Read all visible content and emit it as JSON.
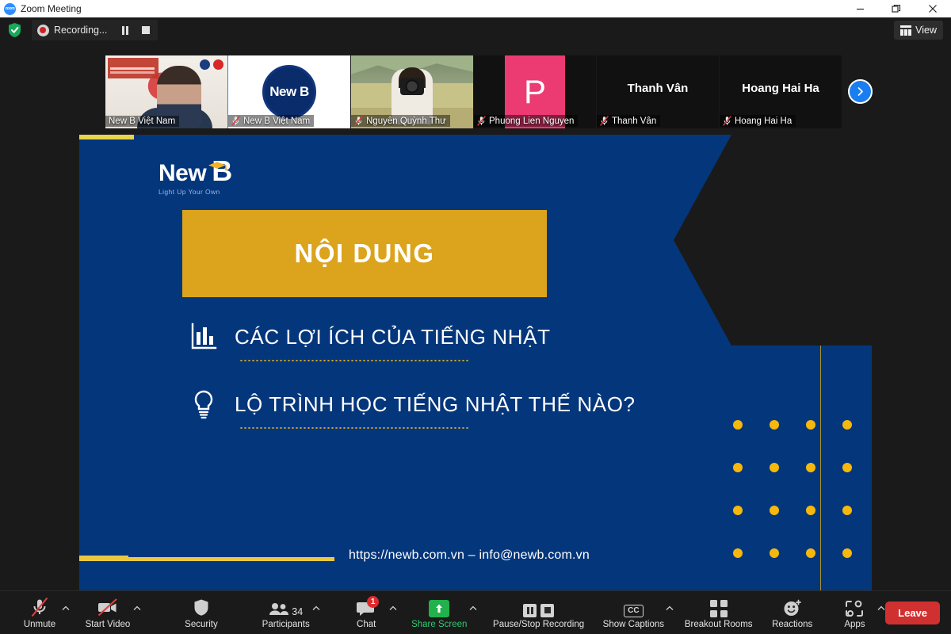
{
  "window": {
    "title": "Zoom Meeting",
    "app_icon": "zoom-logo-icon",
    "minimize": "—",
    "restore": "❐",
    "close": "✕"
  },
  "recording_bar": {
    "security_icon": "shield-check-icon",
    "record_icon": "record-dot-icon",
    "status": "Recording...",
    "pause_icon": "pause-icon",
    "stop_icon": "stop-icon",
    "view_icon": "grid-view-icon",
    "view_label": "View"
  },
  "thumbnails": [
    {
      "name": "New B Việt Nam",
      "muted": false,
      "type": "video",
      "active": true
    },
    {
      "name": "New B Việt Nam",
      "muted": true,
      "type": "logo",
      "logo_text": "New B",
      "active": false
    },
    {
      "name": "Nguyễn Quỳnh Thư",
      "muted": true,
      "type": "photo",
      "active": false
    },
    {
      "name": "Phuong Lien Nguyen",
      "muted": true,
      "type": "initial",
      "initial": "P",
      "color": "#ec3a73",
      "active": false
    },
    {
      "name": "Thanh Vân",
      "muted": true,
      "type": "name",
      "active": false
    },
    {
      "name": "Hoang Hai Ha",
      "muted": true,
      "type": "name",
      "active": false
    }
  ],
  "next_page_button": {
    "icon": "chevron-right-icon"
  },
  "slide": {
    "logo": {
      "word": "New",
      "letter": "B",
      "tagline": "Light Up Your Own",
      "cap_icon": "graduation-cap-icon"
    },
    "title": "NỘI DUNG",
    "bullets": [
      {
        "icon": "bar-chart-icon",
        "text": "CÁC LỢI ÍCH CỦA TIẾNG NHẬT"
      },
      {
        "icon": "lightbulb-icon",
        "text": "LỘ TRÌNH HỌC TIẾNG NHẬT THẾ NÀO?"
      }
    ],
    "footer": "https://newb.com.vn – info@newb.com.vn",
    "colors": {
      "background": "#04367c",
      "accent_gold": "#dca31c",
      "dot_gold": "#f6b80c",
      "rule_gold": "#e9c942"
    }
  },
  "toolbar": {
    "items": [
      {
        "label": "Unmute",
        "icon": "microphone-muted-icon",
        "caret": true
      },
      {
        "label": "Start Video",
        "icon": "video-muted-icon",
        "caret": true
      },
      {
        "label": "Security",
        "icon": "shield-icon",
        "caret": false
      },
      {
        "label": "Participants",
        "icon": "participants-icon",
        "count": "34",
        "caret": true
      },
      {
        "label": "Chat",
        "icon": "chat-icon",
        "badge": "1",
        "caret": true
      },
      {
        "label": "Share Screen",
        "icon": "share-screen-icon",
        "caret": true,
        "highlight": true
      },
      {
        "label": "Pause/Stop Recording",
        "icon": "pause-stop-recording-icon",
        "caret": false
      },
      {
        "label": "Show Captions",
        "icon": "closed-caption-icon",
        "cc_text": "CC",
        "caret": true
      },
      {
        "label": "Breakout Rooms",
        "icon": "breakout-rooms-icon",
        "caret": false
      },
      {
        "label": "Reactions",
        "icon": "reactions-icon",
        "caret": false
      },
      {
        "label": "Apps",
        "icon": "apps-icon",
        "caret": true
      }
    ],
    "leave_label": "Leave"
  }
}
